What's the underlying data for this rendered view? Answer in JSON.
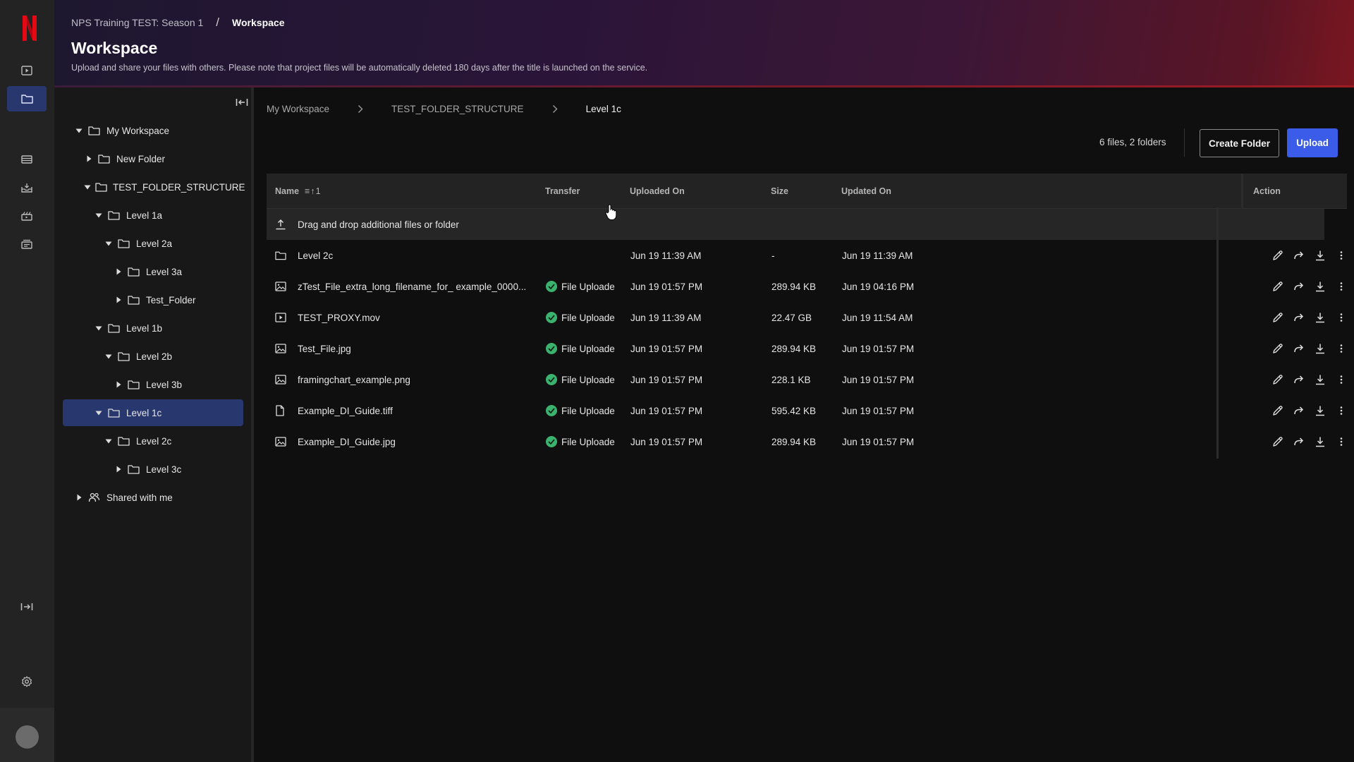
{
  "header": {
    "project": "NPS Training TEST: Season 1",
    "separator": "/",
    "current": "Workspace",
    "title": "Workspace",
    "description": "Upload and share your files with others. Please note that project files will be automatically deleted 180 days after the title is launched on the service."
  },
  "rail": {
    "items": [
      "play-icon",
      "folder-icon",
      "media-icon",
      "inbox-icon",
      "review-icon",
      "delivery-icon"
    ],
    "active": "folder-icon"
  },
  "tree": {
    "items": [
      {
        "label": "My Workspace",
        "indent": 0,
        "caret": "down",
        "icon": "folder"
      },
      {
        "label": "New Folder",
        "indent": 1,
        "caret": "right",
        "icon": "folder"
      },
      {
        "label": "TEST_FOLDER_STRUCTURE",
        "indent": 1,
        "caret": "down",
        "icon": "folder"
      },
      {
        "label": "Level 1a",
        "indent": 2,
        "caret": "down",
        "icon": "folder"
      },
      {
        "label": "Level 2a",
        "indent": 3,
        "caret": "down",
        "icon": "folder"
      },
      {
        "label": "Level 3a",
        "indent": 4,
        "caret": "right",
        "icon": "folder"
      },
      {
        "label": "Test_Folder",
        "indent": 4,
        "caret": "right",
        "icon": "folder"
      },
      {
        "label": "Level 1b",
        "indent": 2,
        "caret": "down",
        "icon": "folder"
      },
      {
        "label": "Level 2b",
        "indent": 3,
        "caret": "down",
        "icon": "folder"
      },
      {
        "label": "Level 3b",
        "indent": 4,
        "caret": "right",
        "icon": "folder"
      },
      {
        "label": "Level 1c",
        "indent": 2,
        "caret": "down",
        "icon": "folder",
        "selected": true
      },
      {
        "label": "Level 2c",
        "indent": 3,
        "caret": "down",
        "icon": "folder"
      },
      {
        "label": "Level 3c",
        "indent": 4,
        "caret": "right",
        "icon": "folder"
      },
      {
        "label": "Shared with me",
        "indent": 0,
        "caret": "right",
        "icon": "shared"
      }
    ]
  },
  "breadcrumb": [
    "My Workspace",
    "TEST_FOLDER_STRUCTURE",
    "Level 1c"
  ],
  "toolbar": {
    "count": "6 files, 2 folders",
    "create_folder": "Create Folder",
    "upload": "Upload"
  },
  "table": {
    "columns": {
      "name": "Name",
      "transfer": "Transfer",
      "uploaded_on": "Uploaded On",
      "size": "Size",
      "updated_on": "Updated On",
      "action": "Action"
    },
    "sort_indicator": "≡↑1",
    "dropzone": "Drag and drop additional files or folder",
    "rows": [
      {
        "icon": "folder",
        "name": "Level 2c",
        "transfer": "",
        "uploaded": "Jun 19 11:39 AM",
        "size": "-",
        "updated": "Jun 19 11:39 AM"
      },
      {
        "icon": "image",
        "name": "zTest_File_extra_long_filename_for_ example_0000...",
        "transfer": "File Uploade",
        "uploaded": "Jun 19 01:57 PM",
        "size": "289.94 KB",
        "updated": "Jun 19 04:16 PM"
      },
      {
        "icon": "video",
        "name": "TEST_PROXY.mov",
        "transfer": "File Uploade",
        "uploaded": "Jun 19 11:39 AM",
        "size": "22.47 GB",
        "updated": "Jun 19 11:54 AM"
      },
      {
        "icon": "image",
        "name": "Test_File.jpg",
        "transfer": "File Uploade",
        "uploaded": "Jun 19 01:57 PM",
        "size": "289.94 KB",
        "updated": "Jun 19 01:57 PM"
      },
      {
        "icon": "image",
        "name": "framingchart_example.png",
        "transfer": "File Uploade",
        "uploaded": "Jun 19 01:57 PM",
        "size": "228.1 KB",
        "updated": "Jun 19 01:57 PM"
      },
      {
        "icon": "document",
        "name": "Example_DI_Guide.tiff",
        "transfer": "File Uploade",
        "uploaded": "Jun 19 01:57 PM",
        "size": "595.42 KB",
        "updated": "Jun 19 01:57 PM"
      },
      {
        "icon": "image",
        "name": "Example_DI_Guide.jpg",
        "transfer": "File Uploade",
        "uploaded": "Jun 19 01:57 PM",
        "size": "289.94 KB",
        "updated": "Jun 19 01:57 PM"
      }
    ]
  },
  "colors": {
    "accent": "#3a5ce8",
    "selected": "#28386e",
    "success": "#3bb36f",
    "brand": "#e50914"
  }
}
